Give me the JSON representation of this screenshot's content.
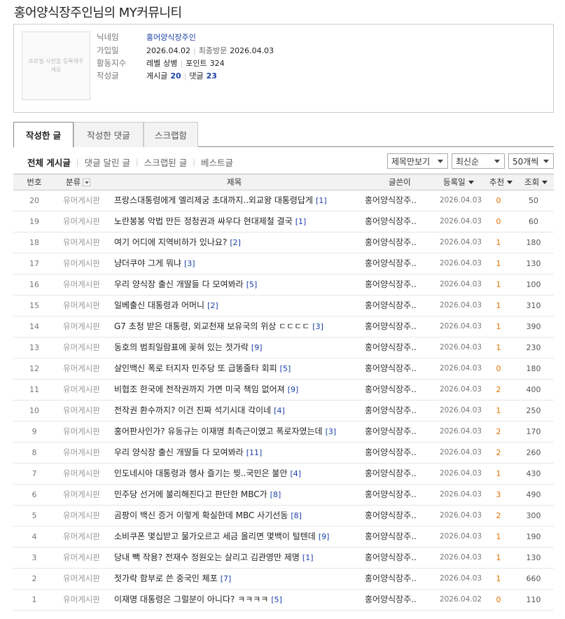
{
  "page_title": "홍어양식장주인님의 MY커뮤니티",
  "profile": {
    "photo_placeholder": "프로필 사진을 등록해주세요",
    "nickname_label": "닉네임",
    "nickname": "홍어양식장주인",
    "joined_label": "가입일",
    "joined": "2026.04.02",
    "last_visit_label": "최종방문",
    "last_visit": "2026.04.03",
    "activity_label": "활동지수",
    "level_label": "레벨",
    "level": "상병",
    "point_label": "포인트",
    "point": "324",
    "posts_label": "작성글",
    "post_count_label": "게시글",
    "post_count": "20",
    "comment_count_label": "댓글",
    "comment_count": "23"
  },
  "tabs": [
    "작성한 글",
    "작성한 댓글",
    "스크랩함"
  ],
  "filters": [
    "전체 게시글",
    "댓글 달린 글",
    "스크랩된 글",
    "베스트글"
  ],
  "selects": {
    "view_mode": "제목만보기",
    "sort": "최신순",
    "per_page": "50개씩"
  },
  "columns": {
    "num": "번호",
    "category": "분류",
    "title": "제목",
    "author": "글쓴이",
    "date": "등록일",
    "recommend": "추천",
    "views": "조회"
  },
  "colors": {
    "link_blue": "#1a3fa8",
    "recommend_orange": "#e07000"
  },
  "posts": [
    {
      "num": "20",
      "category": "유머게시판",
      "title": "프랑스대통령에게 엘리제궁 초대까지..외교왕 대통령답게",
      "comments": "[1]",
      "author": "홍어양식장주..",
      "date": "2026.04.03",
      "recommend": "0",
      "views": "50"
    },
    {
      "num": "19",
      "category": "유머게시판",
      "title": "노란봉봉 악법 만든 정청권과 싸우다 현대제철 결국",
      "comments": "[1]",
      "author": "홍어양식장주..",
      "date": "2026.04.03",
      "recommend": "0",
      "views": "60"
    },
    {
      "num": "18",
      "category": "유머게시판",
      "title": "여기 어디에 지역비하가 있나요?",
      "comments": "[2]",
      "author": "홍어양식장주..",
      "date": "2026.04.03",
      "recommend": "1",
      "views": "180"
    },
    {
      "num": "17",
      "category": "유머게시판",
      "title": "냥더쿠야 그게 뭐냐",
      "comments": "[3]",
      "author": "홍어양식장주..",
      "date": "2026.04.03",
      "recommend": "1",
      "views": "130"
    },
    {
      "num": "16",
      "category": "유머게시판",
      "title": "우리 양식장 출신 개딸들 다 모여봐라",
      "comments": "[5]",
      "author": "홍어양식장주..",
      "date": "2026.04.03",
      "recommend": "1",
      "views": "100"
    },
    {
      "num": "15",
      "category": "유머게시판",
      "title": "일베출신 대통령과 어머니",
      "comments": "[2]",
      "author": "홍어양식장주..",
      "date": "2026.04.03",
      "recommend": "1",
      "views": "310"
    },
    {
      "num": "14",
      "category": "유머게시판",
      "title": "G7 초청 받은 대통령, 외교천재 보유국의 위상 ㄷㄷㄷㄷ",
      "comments": "[3]",
      "author": "홍어양식장주..",
      "date": "2026.04.03",
      "recommend": "1",
      "views": "390"
    },
    {
      "num": "13",
      "category": "유머게시판",
      "title": "동호의 범죄일람표에 꽂혀 있는 젓가락",
      "comments": "[9]",
      "author": "홍어양식장주..",
      "date": "2026.04.03",
      "recommend": "1",
      "views": "230"
    },
    {
      "num": "12",
      "category": "유머게시판",
      "title": "살인백신 폭로 터지자 민주당 또 급똥줄타 회피",
      "comments": "[5]",
      "author": "홍어양식장주..",
      "date": "2026.04.03",
      "recommend": "0",
      "views": "180"
    },
    {
      "num": "11",
      "category": "유머게시판",
      "title": "비협조 한국에 전작권까지 가면 미국 책임 없어져",
      "comments": "[9]",
      "author": "홍어양식장주..",
      "date": "2026.04.03",
      "recommend": "2",
      "views": "400"
    },
    {
      "num": "10",
      "category": "유머게시판",
      "title": "전작권 환수까지? 이건 진짜 석기시대 각이네",
      "comments": "[4]",
      "author": "홍어양식장주..",
      "date": "2026.04.03",
      "recommend": "1",
      "views": "250"
    },
    {
      "num": "9",
      "category": "유머게시판",
      "title": "홍어판사인가? 유동규는 이재명 최측근이였고 폭로자였는데",
      "comments": "[3]",
      "author": "홍어양식장주..",
      "date": "2026.04.03",
      "recommend": "2",
      "views": "170"
    },
    {
      "num": "8",
      "category": "유머게시판",
      "title": "우리 양식장 출신 개딸들 다 모여봐라",
      "comments": "[11]",
      "author": "홍어양식장주..",
      "date": "2026.04.03",
      "recommend": "2",
      "views": "260"
    },
    {
      "num": "7",
      "category": "유머게시판",
      "title": "인도네시아 대통령과 행사 즐기는 찢..국민은 불안",
      "comments": "[4]",
      "author": "홍어양식장주..",
      "date": "2026.04.03",
      "recommend": "1",
      "views": "430"
    },
    {
      "num": "6",
      "category": "유머게시판",
      "title": "민주당 선거에 불리해진다고 판단한 MBC가",
      "comments": "[8]",
      "author": "홍어양식장주..",
      "date": "2026.04.03",
      "recommend": "3",
      "views": "490"
    },
    {
      "num": "5",
      "category": "유머게시판",
      "title": "곰팡이 백신 증거 이렇게 확실한데 MBC 사기선동",
      "comments": "[8]",
      "author": "홍어양식장주..",
      "date": "2026.04.03",
      "recommend": "2",
      "views": "300"
    },
    {
      "num": "4",
      "category": "유머게시판",
      "title": "소비쿠폰 몇십받고 물가오르고 세금 올리면 몇백이 털텐데",
      "comments": "[9]",
      "author": "홍어양식장주..",
      "date": "2026.04.03",
      "recommend": "1",
      "views": "190"
    },
    {
      "num": "3",
      "category": "유머게시판",
      "title": "당내 빽 작용? 전재수 정원오는 살리고 김관영만 제명",
      "comments": "[1]",
      "author": "홍어양식장주..",
      "date": "2026.04.03",
      "recommend": "1",
      "views": "130"
    },
    {
      "num": "2",
      "category": "유머게시판",
      "title": "젓가락 함부로 쓴 중국인 체포",
      "comments": "[7]",
      "author": "홍어양식장주..",
      "date": "2026.04.03",
      "recommend": "1",
      "views": "660"
    },
    {
      "num": "1",
      "category": "유머게시판",
      "title": "이재명 대통령은 그럴분이 아니다? ㅋㅋㅋㅋ",
      "comments": "[5]",
      "author": "홍어양식장주..",
      "date": "2026.04.02",
      "recommend": "0",
      "views": "110"
    }
  ]
}
